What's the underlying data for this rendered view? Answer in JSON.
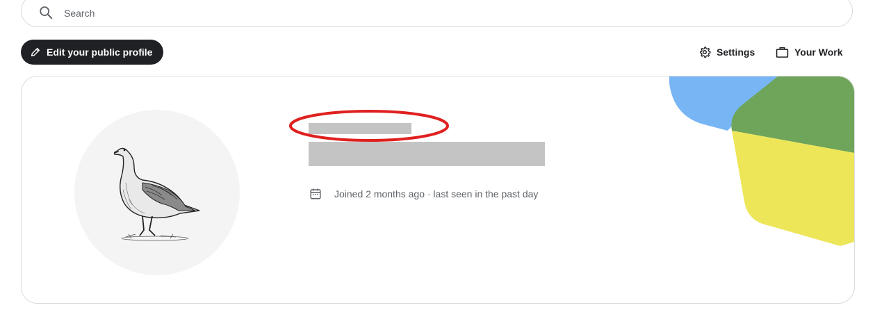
{
  "search": {
    "placeholder": "Search",
    "value": ""
  },
  "toolbar": {
    "edit_profile_label": "Edit your public profile",
    "settings_label": "Settings",
    "your_work_label": "Your Work"
  },
  "profile": {
    "joined_text": "Joined 2 months ago · last seen in the past day",
    "avatar_icon": "goose-illustration",
    "name_redacted": true,
    "bio_redacted": true
  },
  "colors": {
    "dark_button": "#202124",
    "redaction": "#c4c4c4",
    "highlight_ring": "#e02020",
    "decor_blue": "#78b5f5",
    "decor_green": "#6ea55a",
    "decor_yellow": "#ede659"
  }
}
